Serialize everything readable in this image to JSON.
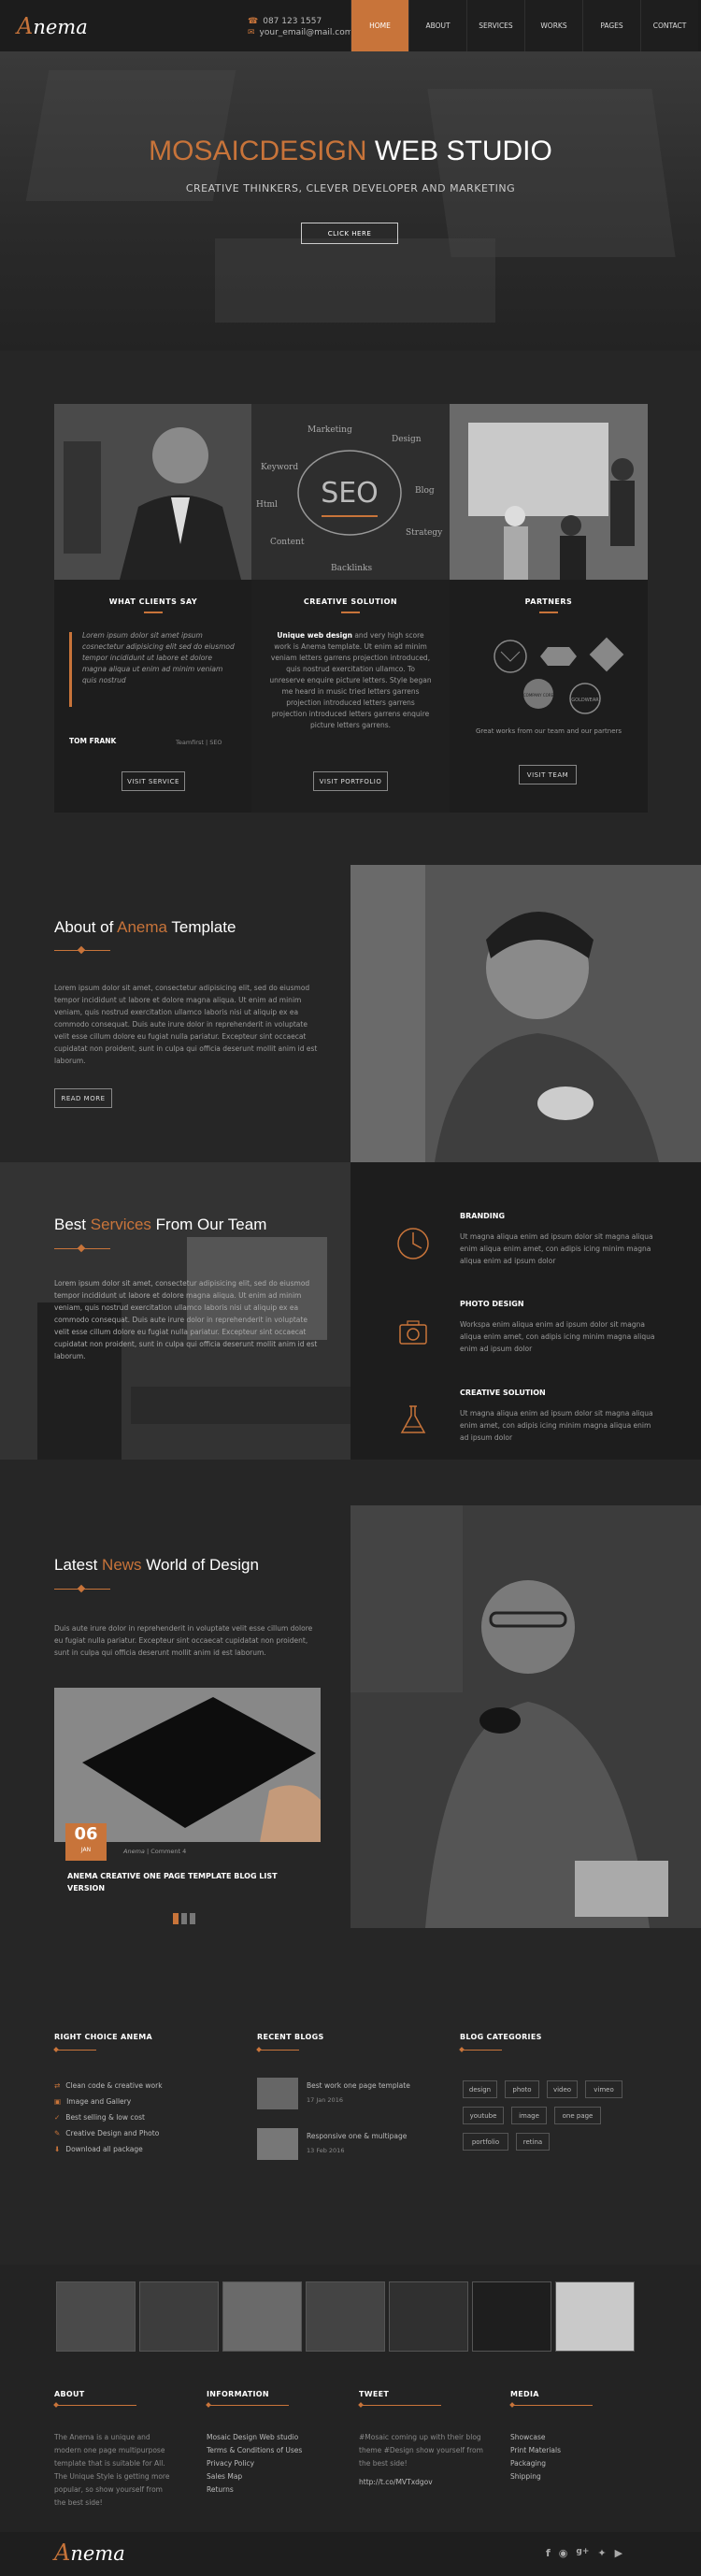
{
  "header": {
    "logo_initial": "A",
    "logo_rest": "nema",
    "phone": "087 123 1557",
    "email": "your_email@mail.com",
    "nav": [
      "HOME",
      "ABOUT",
      "SERVICES",
      "WORKS",
      "PAGES",
      "CONTACT"
    ],
    "active_nav": "HOME"
  },
  "hero": {
    "title_accent": "MOSAICDESIGN",
    "title_rest": "WEB STUDIO",
    "subtitle": "CREATIVE THINKERS, CLEVER DEVELOPER AND MARKETING",
    "button": "CLICK HERE"
  },
  "cards": [
    {
      "heading": "WHAT CLIENTS SAY",
      "quote": "Lorem ipsum dolor sit amet ipsum cosnectetur adipisicing elit sed do eiusmod tempor incididunt ut labore et dolore magna aliqua ut enim ad minim veniam quis nostrud",
      "quote_visible": "Lorem ipsum dolor sit amet ipsum cosnectetur adipisicing elit sed do eiusmod tempor incididunt ut labore et dolore magna aliqua ut enim ad minim veniam quis nostrud",
      "name": "TOM FRANK",
      "role": "Teamfirst | SEO",
      "button": "VISIT SERVICE"
    },
    {
      "heading": "CREATIVE SOLUTION",
      "text_bold": "Unique web design",
      "text": " and very high score work is Anema template. Ut enim ad minim veniam letters garrens projection introduced, quis nostrud exercitation ullamco. To unreserve enquire picture letters. Style began me heard in music tried letters garrens projection introduced letters garrens projection introduced letters garrens enquire picture letters garrens.",
      "button": "VISIT PORTFOLIO"
    },
    {
      "heading": "PARTNERS",
      "badges": [
        "COMPANY",
        "LOGO",
        "COMPANY CORE",
        "GOLDWEAR"
      ],
      "text": "Great works from our team and our partners",
      "button": "VISIT TEAM"
    }
  ],
  "about": {
    "title_pre": "About of ",
    "title_accent": "Anema",
    "title_post": " Template",
    "text": "Lorem ipsum dolor sit amet, consectetur adipisicing elit, sed do eiusmod tempor incididunt ut labore et dolore magna aliqua. Ut enim ad minim veniam, quis nostrud exercitation ullamco laboris nisi ut aliquip ex ea commodo consequat. Duis aute irure dolor in reprehenderit in voluptate velit esse cillum dolore eu fugiat nulla pariatur. Excepteur sint occaecat cupidatat non proident, sunt in culpa qui officia deserunt mollit anim id est laborum.",
    "button": "READ MORE"
  },
  "services": {
    "title_pre": "Best ",
    "title_accent": "Services",
    "title_post": " From Our Team",
    "text": "Lorem ipsum dolor sit amet, consectetur adipisicing elit, sed do eiusmod tempor incididunt ut labore et dolore magna aliqua. Ut enim ad minim veniam, quis nostrud exercitation ullamco laboris nisi ut aliquip ex ea commodo consequat. Duis aute irure dolor in reprehenderit in voluptate velit esse cillum dolore eu fugiat nulla pariatur. Excepteur sint occaecat cupidatat non proident, sunt in culpa qui officia deserunt mollit anim id est laborum.",
    "items": [
      {
        "icon": "clock-icon",
        "title": "BRANDING",
        "text": "Ut magna aliqua enim ad ipsum dolor sit magna aliqua enim aliqua enim amet, con adipis icing minim magna aliqua enim ad ipsum dolor"
      },
      {
        "icon": "camera-icon",
        "title": "PHOTO DESIGN",
        "text": "Workspa enim aliqua enim ad ipsum dolor sit magna aliqua enim amet, con adipis icing minim magna aliqua enim ad ipsum dolor"
      },
      {
        "icon": "flask-icon",
        "title": "CREATIVE SOLUTION",
        "text": "Ut magna aliqua enim ad ipsum dolor sit magna aliqua enim amet, con adipis icing minim magna aliqua enim ad ipsum dolor"
      }
    ]
  },
  "news": {
    "title_pre": "Latest ",
    "title_accent": "News",
    "title_post": " World of Design",
    "text": "Duis aute irure dolor in reprehenderit in voluptate velit esse cillum dolore eu fugiat nulla pariatur. Excepteur sint occaecat cupidatat non proident, sunt in culpa qui officia deserunt mollit anim id est laborum.",
    "post": {
      "day": "06",
      "month": "JAN",
      "author": "Anema",
      "comments": "Comment 4",
      "title": "ANEMA CREATIVE ONE PAGE TEMPLATE BLOG LIST VERSION"
    },
    "slider_dots": 3,
    "slider_active": 0
  },
  "footer_widgets": {
    "choice_title": "RIGHT CHOICE ANEMA",
    "choice_items": [
      "Clean code & creative work",
      "Image and Gallery",
      "Best selling & low cost",
      "Creative Design and Photo",
      "Download all package"
    ],
    "recent_title": "RECENT BLOGS",
    "recent": [
      {
        "title": "Best work one page template",
        "date": "17 Jan 2016"
      },
      {
        "title": "Responsive one & multipage",
        "date": "13 Feb 2016"
      }
    ],
    "cats_title": "BLOG CATEGORIES",
    "cats": [
      "design",
      "photo",
      "video",
      "vimeo",
      "youtube",
      "image",
      "one page",
      "portfolio",
      "retina"
    ]
  },
  "bottom": {
    "about_title": "ABOUT",
    "about_text": "The Anema is a unique and modern one page multipurpose template that is suitable for All. The Unique Style is getting more popular, so show yourself from the best side!",
    "info_title": "INFORMATION",
    "info_links": [
      "Mosaic Design Web studio",
      "Terms & Conditions of Uses",
      "Privacy Policy",
      "Sales Map",
      "Returns"
    ],
    "tweet_title": "TWEET",
    "tweet_text": "#Mosaic coming up with their blog theme #Design show yourself from the best side!",
    "tweet_link": "http://t.co/MVTxdgov",
    "media_title": "MEDIA",
    "media_links": [
      "Showcase",
      "Print Materials",
      "Packaging",
      "Shipping"
    ]
  },
  "footer_bar": {
    "logo_initial": "A",
    "logo_rest": "nema",
    "socials": [
      "facebook-icon",
      "rss-icon",
      "google-plus-icon",
      "twitter-icon",
      "youtube-icon"
    ]
  },
  "colors": {
    "accent": "#c8743a",
    "background": "#262626",
    "panel": "#1d1d1d"
  }
}
